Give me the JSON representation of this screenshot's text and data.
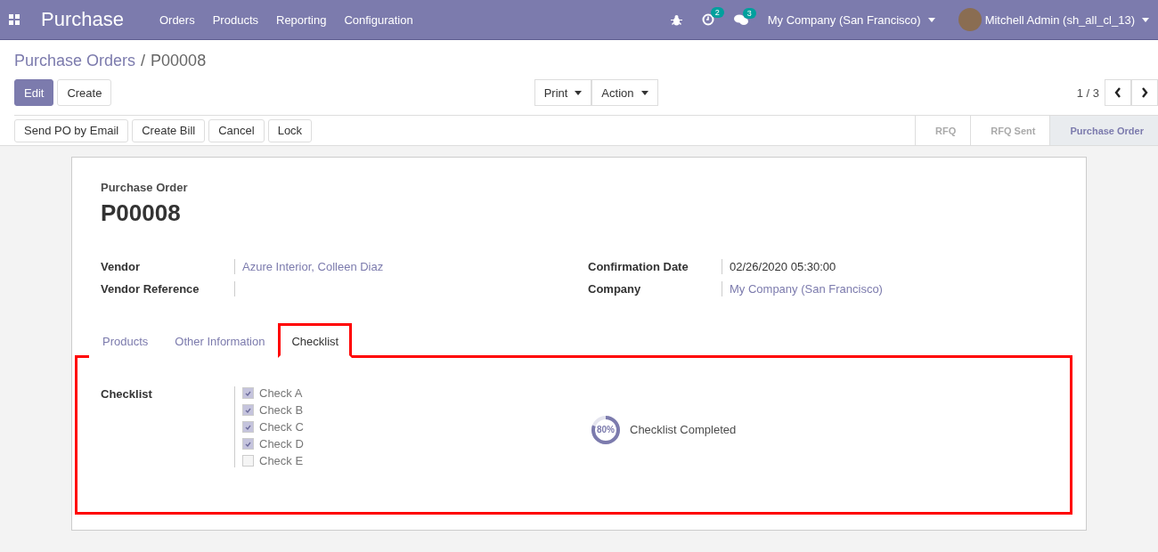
{
  "navbar": {
    "app_title": "Purchase",
    "menu": [
      "Orders",
      "Products",
      "Reporting",
      "Configuration"
    ],
    "activity_count": "2",
    "message_count": "3",
    "company": "My Company (San Francisco)",
    "user": "Mitchell Admin (sh_all_cl_13)"
  },
  "breadcrumb": {
    "parent": "Purchase Orders",
    "separator": "/",
    "current": "P00008"
  },
  "main_buttons": [
    {
      "label": "Edit",
      "primary": true
    },
    {
      "label": "Create",
      "primary": false
    }
  ],
  "dropdowns": [
    "Print",
    "Action"
  ],
  "pager": "1 / 3",
  "actions": [
    "Send PO by Email",
    "Create Bill",
    "Cancel",
    "Lock"
  ],
  "status_steps": [
    {
      "label": "RFQ",
      "selected": false
    },
    {
      "label": "RFQ Sent",
      "selected": false
    },
    {
      "label": "Purchase Order",
      "selected": true
    }
  ],
  "sheet": {
    "subtitle": "Purchase Order",
    "name": "P00008",
    "left_fields": [
      {
        "label": "Vendor",
        "value": "Azure Interior, Colleen Diaz",
        "link": true
      },
      {
        "label": "Vendor Reference"
      }
    ],
    "right_fields": [
      {
        "label": "Confirmation Date",
        "value": "02/26/2020 05:30:00",
        "link": false
      },
      {
        "label": "Company",
        "value": "My Company (San Francisco)",
        "link": true
      }
    ],
    "tabs": [
      {
        "label": "Products",
        "selected": false
      },
      {
        "label": "Other Information",
        "selected": false
      },
      {
        "label": "Checklist",
        "selected": true
      }
    ],
    "checklist_label": "Checklist",
    "checks": [
      {
        "label": "Check A",
        "checked": true
      },
      {
        "label": "Check B",
        "checked": true
      },
      {
        "label": "Check C",
        "checked": true
      },
      {
        "label": "Check D",
        "checked": true
      },
      {
        "label": "Check E",
        "checked": false
      }
    ],
    "progress": {
      "level": 0.8,
      "reading": "80%",
      "caption": "Checklist Completed"
    }
  }
}
